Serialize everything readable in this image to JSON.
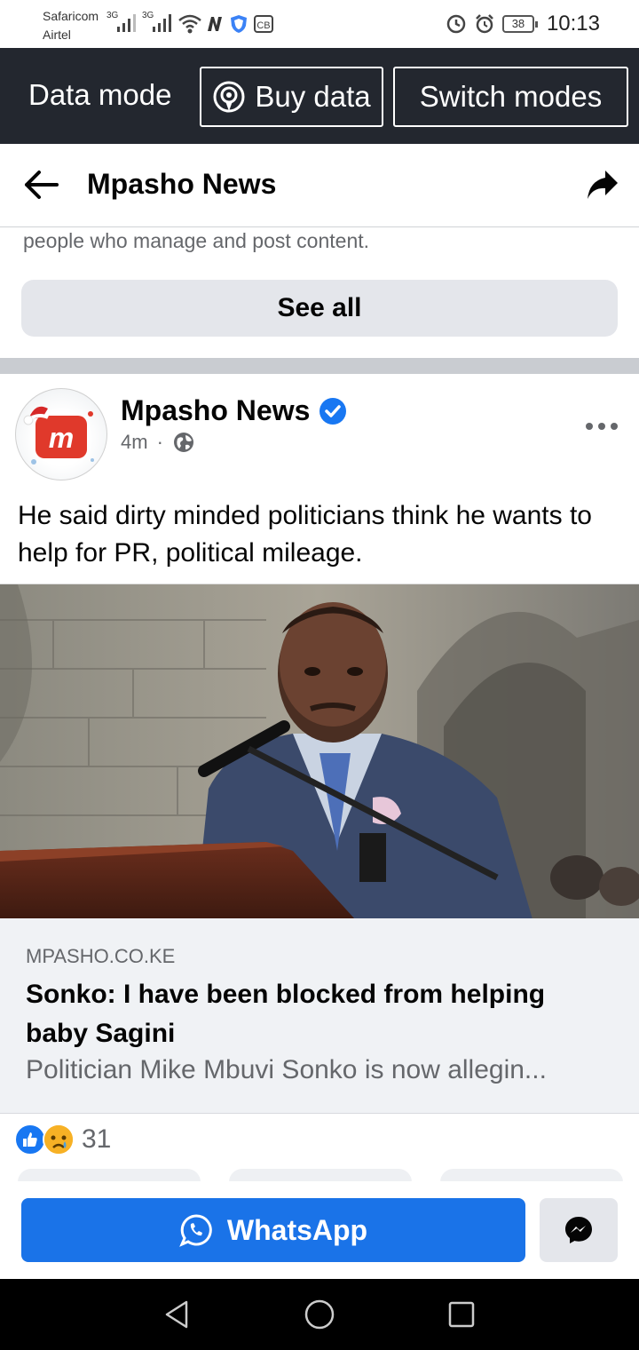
{
  "status_bar": {
    "carrier_1": "Safaricom",
    "carrier_2": "Airtel",
    "network_1": "3G",
    "network_2": "3G",
    "battery": "38",
    "time": "10:13"
  },
  "data_mode_bar": {
    "title": "Data mode",
    "buy_data_label": "Buy data",
    "switch_modes_label": "Switch modes"
  },
  "header": {
    "title": "Mpasho News"
  },
  "about": {
    "text": "people who manage and post content.",
    "see_all_label": "See all"
  },
  "post": {
    "author": "Mpasho News",
    "time": "4m",
    "separator": "·",
    "text": "He said dirty minded politicians think he wants to help for PR, political mileage.",
    "avatar_letter": "m",
    "link": {
      "domain": "MPASHO.CO.KE",
      "title": "Sonko: I have been blocked from helping baby Sagini",
      "description": "Politician Mike Mbuvi Sonko is now allegin..."
    },
    "reaction_count": "31"
  },
  "actions": {
    "whatsapp_label": "WhatsApp"
  },
  "colors": {
    "data_bar_bg": "#23272f",
    "whatsapp_button": "#1a73e8",
    "verified_badge": "#1877f2",
    "avatar_brand": "#e0392b"
  },
  "icons": {
    "back": "arrow-left-icon",
    "share": "share-arrow-icon",
    "verified": "verified-check-icon",
    "public": "globe-icon",
    "more": "more-dots-icon",
    "like": "like-reaction-icon",
    "sad": "sad-reaction-icon",
    "whatsapp": "whatsapp-icon",
    "messenger": "messenger-icon",
    "hotspot": "hotspot-icon"
  }
}
